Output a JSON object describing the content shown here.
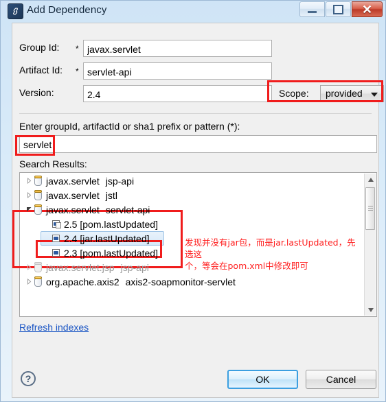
{
  "window": {
    "title": "Add Dependency",
    "icon": "maven-dependency-icon",
    "minimize_label": "Minimize",
    "maximize_label": "Maximize",
    "close_label": "✕"
  },
  "form": {
    "group_id": {
      "label": "Group Id:",
      "required_mark": "*",
      "value": "javax.servlet"
    },
    "artifact_id": {
      "label": "Artifact Id:",
      "required_mark": "*",
      "value": "servlet-api"
    },
    "version": {
      "label": "Version:",
      "value": "2.4"
    },
    "scope": {
      "label": "Scope:",
      "value": "provided"
    }
  },
  "search": {
    "hint": "Enter groupId, artifactId or sha1 prefix or pattern (*):",
    "value": "servlet",
    "results_label": "Search Results:"
  },
  "tree": {
    "rows": [
      {
        "twisty": "collapsed",
        "icon": "jar-icon",
        "indent": 0,
        "group": "javax.servlet",
        "artifact": "jsp-api",
        "state": "normal"
      },
      {
        "twisty": "collapsed",
        "icon": "jar-icon",
        "indent": 0,
        "group": "javax.servlet",
        "artifact": "jstl",
        "state": "normal"
      },
      {
        "twisty": "expanded",
        "icon": "jar-icon",
        "indent": 0,
        "group": "javax.servlet",
        "artifact": "servlet-api",
        "state": "normal"
      },
      {
        "twisty": "none",
        "icon": "version-pom-icon",
        "indent": 1,
        "group": "2.5 [pom.lastUpdated]",
        "artifact": "",
        "state": "normal"
      },
      {
        "twisty": "none",
        "icon": "version-jar-icon",
        "indent": 1,
        "group": "2.4 [jar.lastUpdated]",
        "artifact": "",
        "state": "selected"
      },
      {
        "twisty": "none",
        "icon": "version-jar-icon",
        "indent": 1,
        "group": "2.3 [pom.lastUpdated]",
        "artifact": "",
        "state": "normal"
      },
      {
        "twisty": "collapsed",
        "icon": "jar-icon",
        "indent": 0,
        "group": "javax.servlet.jsp",
        "artifact": "jsp-api",
        "state": "disabled"
      },
      {
        "twisty": "collapsed",
        "icon": "jar-icon",
        "indent": 0,
        "group": "org.apache.axis2",
        "artifact": "axis2-soapmonitor-servlet",
        "state": "normal"
      }
    ],
    "scrollbar": {
      "up": "scroll-up",
      "down": "scroll-down"
    }
  },
  "footer": {
    "refresh_link": "Refresh indexes",
    "help": "?",
    "ok": "OK",
    "cancel": "Cancel"
  },
  "annotations": {
    "note": "发现并没有jar包，而是jar.lastUpdated，先选这\n个，等会在pom.xml中修改即可",
    "color": "#ff2020"
  }
}
